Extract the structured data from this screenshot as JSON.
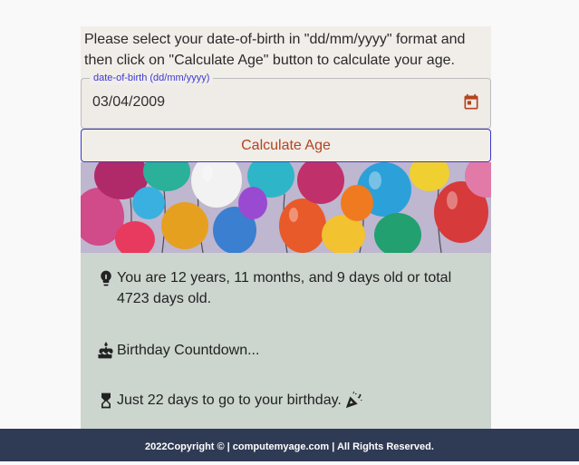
{
  "instructions": "Please select your date-of-birth in \"dd/mm/yyyy\" format and then click on \"Calculate Age\" button to calculate your age.",
  "dob": {
    "label": "date-of-birth (dd/mm/yyyy)",
    "value": "03/04/2009",
    "icon": "calendar-icon"
  },
  "calculate_label": "Calculate Age",
  "banner_image": "colorful-balloons",
  "results": {
    "age_text": "You are 12 years, 11 months, and 9 days old or total 4723 days old.",
    "countdown_title": "Birthday Countdown...",
    "countdown_text": "Just 22 days to go to your birthday."
  },
  "footer_text": "2022Copyright © | computemyage.com | All Rights Reserved.",
  "colors": {
    "accent": "#b3441e",
    "legend": "#3b3bd0",
    "result_bg": "#cdd5cf",
    "footer_bg": "#2f3b54"
  }
}
